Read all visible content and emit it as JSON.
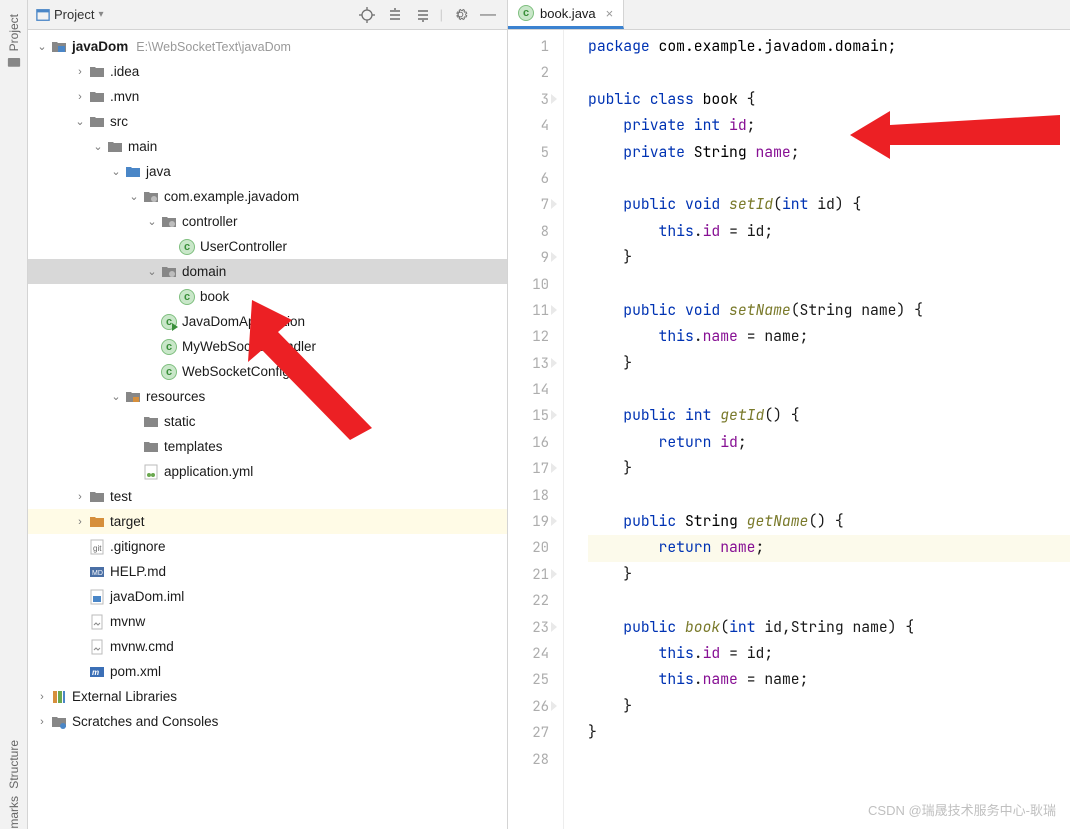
{
  "sidebar_labels": {
    "project": "Project",
    "structure": "Structure",
    "bookmarks": "marks"
  },
  "panel": {
    "title": "Project"
  },
  "tree": {
    "root": {
      "name": "javaDom",
      "hint": "E:\\WebSocketText\\javaDom"
    },
    "items": [
      {
        "depth": 1,
        "arrow": ">",
        "icon": "folder",
        "label": ".idea"
      },
      {
        "depth": 1,
        "arrow": ">",
        "icon": "folder",
        "label": ".mvn"
      },
      {
        "depth": 1,
        "arrow": "v",
        "icon": "folder",
        "label": "src"
      },
      {
        "depth": 2,
        "arrow": "v",
        "icon": "folder",
        "label": "main"
      },
      {
        "depth": 3,
        "arrow": "v",
        "icon": "folder-blue",
        "label": "java"
      },
      {
        "depth": 4,
        "arrow": "v",
        "icon": "package",
        "label": "com.example.javadom"
      },
      {
        "depth": 5,
        "arrow": "v",
        "icon": "package",
        "label": "controller"
      },
      {
        "depth": 6,
        "arrow": " ",
        "icon": "class",
        "label": "UserController"
      },
      {
        "depth": 5,
        "arrow": "v",
        "icon": "package",
        "label": "domain",
        "selected": true
      },
      {
        "depth": 6,
        "arrow": " ",
        "icon": "class",
        "label": "book"
      },
      {
        "depth": 5,
        "arrow": " ",
        "icon": "class-run",
        "label": "JavaDomApplication"
      },
      {
        "depth": 5,
        "arrow": " ",
        "icon": "class",
        "label": "MyWebSocketHandler"
      },
      {
        "depth": 5,
        "arrow": " ",
        "icon": "class",
        "label": "WebSocketConfig"
      },
      {
        "depth": 3,
        "arrow": "v",
        "icon": "folder-res",
        "label": "resources"
      },
      {
        "depth": 4,
        "arrow": " ",
        "icon": "folder",
        "label": "static"
      },
      {
        "depth": 4,
        "arrow": " ",
        "icon": "folder",
        "label": "templates"
      },
      {
        "depth": 4,
        "arrow": " ",
        "icon": "yml",
        "label": "application.yml"
      },
      {
        "depth": 1,
        "arrow": ">",
        "icon": "folder",
        "label": "test"
      },
      {
        "depth": 1,
        "arrow": ">",
        "icon": "folder-orange",
        "label": "target",
        "excluded": true
      },
      {
        "depth": 1,
        "arrow": " ",
        "icon": "gitignore",
        "label": ".gitignore"
      },
      {
        "depth": 1,
        "arrow": " ",
        "icon": "md",
        "label": "HELP.md"
      },
      {
        "depth": 1,
        "arrow": " ",
        "icon": "iml",
        "label": "javaDom.iml"
      },
      {
        "depth": 1,
        "arrow": " ",
        "icon": "file",
        "label": "mvnw"
      },
      {
        "depth": 1,
        "arrow": " ",
        "icon": "file",
        "label": "mvnw.cmd"
      },
      {
        "depth": 1,
        "arrow": " ",
        "icon": "maven",
        "label": "pom.xml"
      }
    ],
    "ext_libs": "External Libraries",
    "scratches": "Scratches and Consoles"
  },
  "tab": {
    "filename": "book.java"
  },
  "code": {
    "lines": [
      {
        "n": 1,
        "tokens": [
          {
            "t": "package ",
            "c": "kw"
          },
          {
            "t": "com.example.javadom.domain;",
            "c": "pkg"
          }
        ]
      },
      {
        "n": 2,
        "tokens": []
      },
      {
        "n": 3,
        "tokens": [
          {
            "t": "public class ",
            "c": "kw"
          },
          {
            "t": "book ",
            "c": "cls"
          },
          {
            "t": "{",
            "c": ""
          }
        ]
      },
      {
        "n": 4,
        "tokens": [
          {
            "t": "    ",
            "c": ""
          },
          {
            "t": "private int ",
            "c": "kw"
          },
          {
            "t": "id",
            "c": "fld"
          },
          {
            "t": ";",
            "c": ""
          }
        ]
      },
      {
        "n": 5,
        "tokens": [
          {
            "t": "    ",
            "c": ""
          },
          {
            "t": "private ",
            "c": "kw"
          },
          {
            "t": "String ",
            "c": "ty"
          },
          {
            "t": "name",
            "c": "fld"
          },
          {
            "t": ";",
            "c": ""
          }
        ]
      },
      {
        "n": 6,
        "tokens": []
      },
      {
        "n": 7,
        "tokens": [
          {
            "t": "    ",
            "c": ""
          },
          {
            "t": "public void ",
            "c": "kw"
          },
          {
            "t": "setId",
            "c": "mth"
          },
          {
            "t": "(",
            "c": ""
          },
          {
            "t": "int ",
            "c": "kw"
          },
          {
            "t": "id) {",
            "c": ""
          }
        ]
      },
      {
        "n": 8,
        "tokens": [
          {
            "t": "        ",
            "c": ""
          },
          {
            "t": "this",
            "c": "kw"
          },
          {
            "t": ".",
            "c": ""
          },
          {
            "t": "id",
            "c": "fld"
          },
          {
            "t": " = id;",
            "c": ""
          }
        ]
      },
      {
        "n": 9,
        "tokens": [
          {
            "t": "    }",
            "c": ""
          }
        ]
      },
      {
        "n": 10,
        "tokens": []
      },
      {
        "n": 11,
        "tokens": [
          {
            "t": "    ",
            "c": ""
          },
          {
            "t": "public void ",
            "c": "kw"
          },
          {
            "t": "setName",
            "c": "mth"
          },
          {
            "t": "(String name) {",
            "c": ""
          }
        ]
      },
      {
        "n": 12,
        "tokens": [
          {
            "t": "        ",
            "c": ""
          },
          {
            "t": "this",
            "c": "kw"
          },
          {
            "t": ".",
            "c": ""
          },
          {
            "t": "name",
            "c": "fld"
          },
          {
            "t": " = name;",
            "c": ""
          }
        ]
      },
      {
        "n": 13,
        "tokens": [
          {
            "t": "    }",
            "c": ""
          }
        ]
      },
      {
        "n": 14,
        "tokens": []
      },
      {
        "n": 15,
        "tokens": [
          {
            "t": "    ",
            "c": ""
          },
          {
            "t": "public int ",
            "c": "kw"
          },
          {
            "t": "getId",
            "c": "mth"
          },
          {
            "t": "() {",
            "c": ""
          }
        ]
      },
      {
        "n": 16,
        "tokens": [
          {
            "t": "        ",
            "c": ""
          },
          {
            "t": "return ",
            "c": "kw"
          },
          {
            "t": "id",
            "c": "fld"
          },
          {
            "t": ";",
            "c": ""
          }
        ]
      },
      {
        "n": 17,
        "tokens": [
          {
            "t": "    }",
            "c": ""
          }
        ]
      },
      {
        "n": 18,
        "tokens": []
      },
      {
        "n": 19,
        "tokens": [
          {
            "t": "    ",
            "c": ""
          },
          {
            "t": "public ",
            "c": "kw"
          },
          {
            "t": "String ",
            "c": "ty"
          },
          {
            "t": "getName",
            "c": "mth"
          },
          {
            "t": "() {",
            "c": ""
          }
        ]
      },
      {
        "n": 20,
        "tokens": [
          {
            "t": "        ",
            "c": ""
          },
          {
            "t": "return ",
            "c": "kw"
          },
          {
            "t": "name",
            "c": "fld"
          },
          {
            "t": ";",
            "c": ""
          }
        ],
        "hl": true
      },
      {
        "n": 21,
        "tokens": [
          {
            "t": "    }",
            "c": ""
          }
        ]
      },
      {
        "n": 22,
        "tokens": []
      },
      {
        "n": 23,
        "tokens": [
          {
            "t": "    ",
            "c": ""
          },
          {
            "t": "public ",
            "c": "kw"
          },
          {
            "t": "book",
            "c": "mth"
          },
          {
            "t": "(",
            "c": ""
          },
          {
            "t": "int ",
            "c": "kw"
          },
          {
            "t": "id,String name) {",
            "c": ""
          }
        ]
      },
      {
        "n": 24,
        "tokens": [
          {
            "t": "        ",
            "c": ""
          },
          {
            "t": "this",
            "c": "kw"
          },
          {
            "t": ".",
            "c": ""
          },
          {
            "t": "id",
            "c": "fld"
          },
          {
            "t": " = id;",
            "c": ""
          }
        ]
      },
      {
        "n": 25,
        "tokens": [
          {
            "t": "        ",
            "c": ""
          },
          {
            "t": "this",
            "c": "kw"
          },
          {
            "t": ".",
            "c": ""
          },
          {
            "t": "name",
            "c": "fld"
          },
          {
            "t": " = name;",
            "c": ""
          }
        ]
      },
      {
        "n": 26,
        "tokens": [
          {
            "t": "    }",
            "c": ""
          }
        ]
      },
      {
        "n": 27,
        "tokens": [
          {
            "t": "}",
            "c": ""
          }
        ]
      },
      {
        "n": 28,
        "tokens": []
      }
    ]
  },
  "watermark": "CSDN @瑞晟技术服务中心-耿瑞"
}
